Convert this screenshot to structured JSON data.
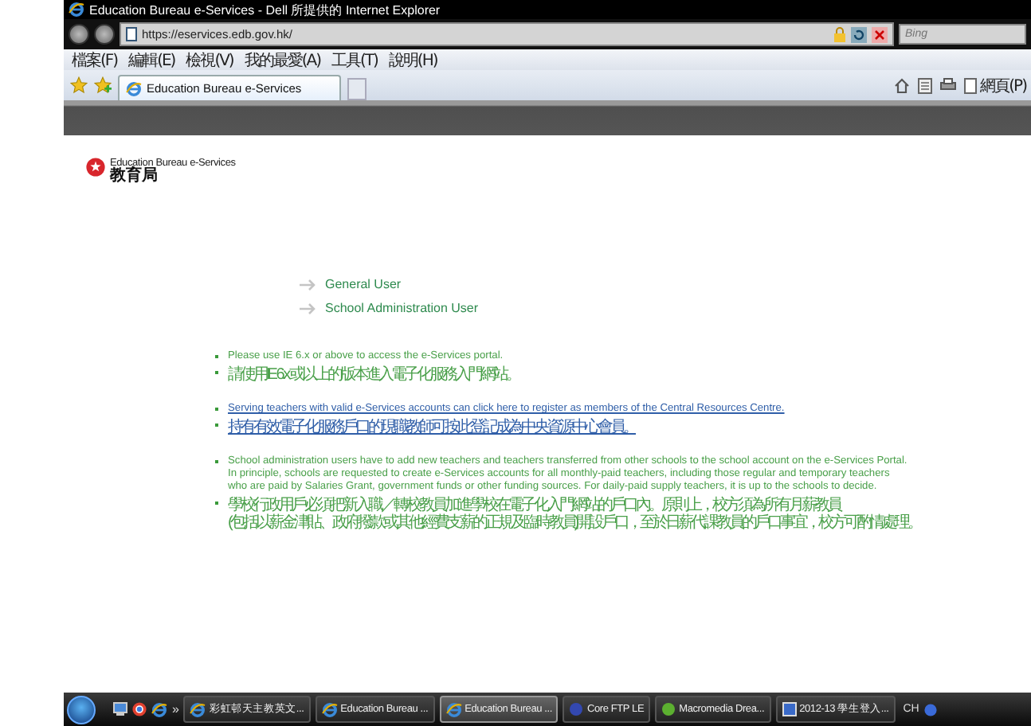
{
  "window": {
    "title": "Education Bureau e-Services - Dell 所提供的 Internet Explorer"
  },
  "address_bar": {
    "url": "https://eservices.edb.gov.hk/"
  },
  "search": {
    "placeholder": "Bing"
  },
  "menu": [
    "檔案(F)",
    "編輯(E)",
    "檢視(V)",
    "我的最愛(A)",
    "工具(T)",
    "說明(H)"
  ],
  "tabs": [
    {
      "label": "Education Bureau e-Services",
      "selected": true
    }
  ],
  "command_bar": {
    "page_menu": "網頁(P)"
  },
  "logo": {
    "english": "Education Bureau e-Services",
    "chinese": "教育局"
  },
  "login_links": [
    "General User",
    "School Administration User"
  ],
  "notice_groups": [
    {
      "items": [
        {
          "kind": "text",
          "lines": [
            "Please use IE 6.x or above to access the e-Services portal."
          ]
        },
        {
          "kind": "text",
          "lines": [
            "請使用IE 6.x 或以上的版本進入電子化服務入門網站。"
          ]
        }
      ]
    },
    {
      "items": [
        {
          "kind": "link",
          "lines": [
            "Serving teachers with valid e-Services accounts can click here to register as members of the Central Resources Centre."
          ]
        },
        {
          "kind": "link",
          "lines": [
            "持有有效電子化服務戶口的現職教師可按此登記成為中央資源中心會員。"
          ]
        }
      ]
    },
    {
      "items": [
        {
          "kind": "text",
          "lines": [
            "School administration users have to add new teachers and teachers transferred from other schools to the school account on the e-Services Portal.",
            "In principle, schools are requested to create e-Services accounts for all monthly-paid teachers, including those regular and temporary teachers",
            "who are paid by Salaries Grant, government funds or other funding sources. For daily-paid supply teachers, it is up to the schools to decide."
          ]
        },
        {
          "kind": "text",
          "lines": [
            "學校行政用戶必須把新入職／轉校教員加進學校在電子化入門網站的戶口內。原則上，校方須為所有月薪教員",
            "(包括以薪金津貼、政府撥款或其他經費支薪的正規及臨時教員)開設戶口，至於日薪代課教員的戶口事宜，校方可酌情處理。"
          ]
        }
      ]
    }
  ],
  "taskbar": {
    "quick_launch_more": "»",
    "buttons": [
      {
        "label": "彩虹邨天主教英文...",
        "selected": false,
        "kind": "ie"
      },
      {
        "label": "Education Bureau ...",
        "selected": false,
        "kind": "ie"
      },
      {
        "label": "Education Bureau ...",
        "selected": true,
        "kind": "ie"
      },
      {
        "label": "Core FTP LE",
        "selected": false,
        "kind": "ftp"
      },
      {
        "label": "Macromedia Drea...",
        "selected": false,
        "kind": "dw"
      },
      {
        "label": "2012-13 學生登入...",
        "selected": false,
        "kind": "doc"
      }
    ],
    "language": "CH"
  }
}
